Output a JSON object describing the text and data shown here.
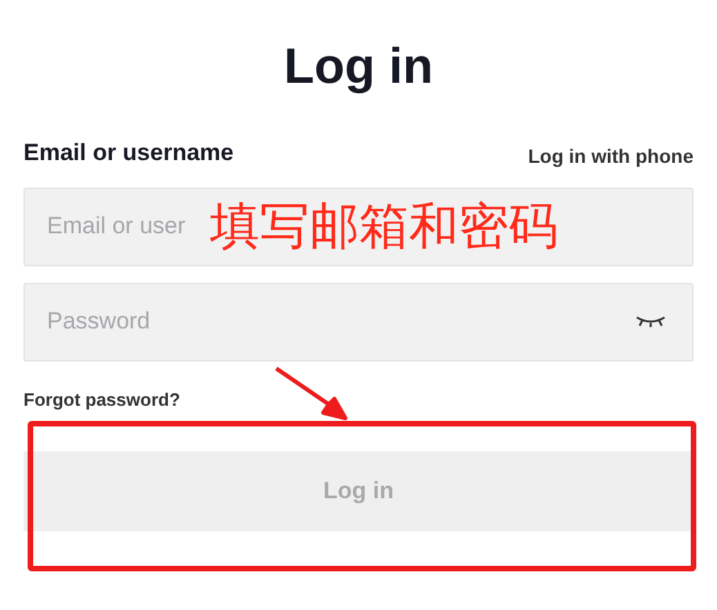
{
  "title": "Log in",
  "email_label": "Email or username",
  "phone_link": "Log in with phone",
  "email_field": {
    "placeholder": "Email or user"
  },
  "password_field": {
    "placeholder": "Password"
  },
  "forgot_link": "Forgot password?",
  "login_button": {
    "label": "Log in",
    "disabled": true
  },
  "annotation": {
    "text": "填写邮箱和密码"
  }
}
